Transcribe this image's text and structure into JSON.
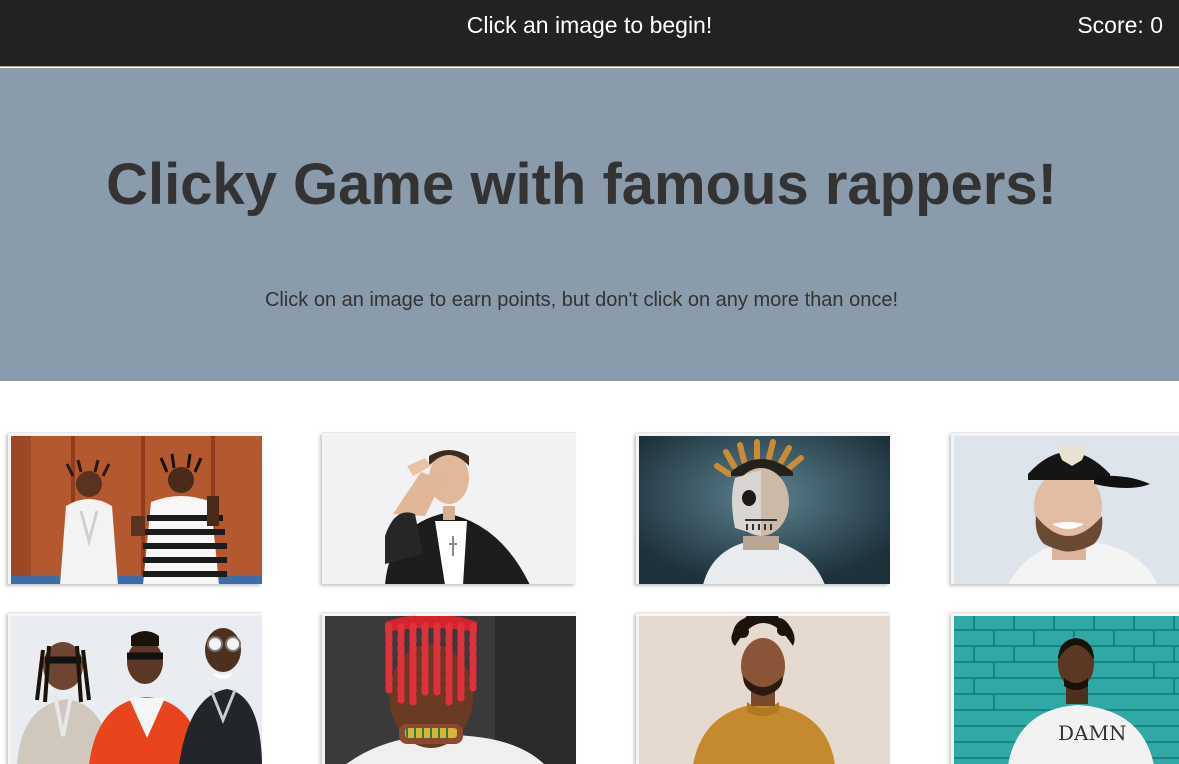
{
  "navbar": {
    "message": "Click an image to begin!",
    "score_label": "Score: 0"
  },
  "hero": {
    "title": "Clicky Game with famous rappers!",
    "subtitle": "Click on an image to earn points, but don't click on any more than once!"
  },
  "cards": [
    {
      "name": "rapper-card-duo-orange-wall"
    },
    {
      "name": "rapper-card-pointing-leather-jacket"
    },
    {
      "name": "rapper-card-skull-face"
    },
    {
      "name": "rapper-card-black-cap-smiling"
    },
    {
      "name": "rapper-card-trio-sunglasses"
    },
    {
      "name": "rapper-card-red-braids"
    },
    {
      "name": "rapper-card-afro-mustard-shirt"
    },
    {
      "name": "rapper-card-teal-brick-wall"
    }
  ],
  "card_art": {
    "damn_shirt_text": "DAMN"
  }
}
